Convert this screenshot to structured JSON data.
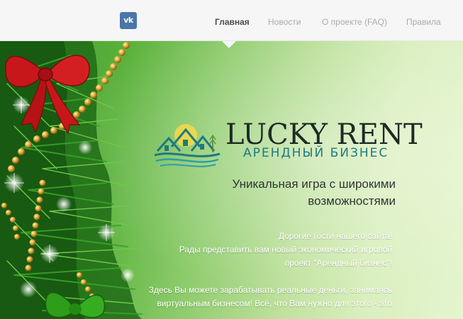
{
  "header": {
    "vk_icon": "vk-icon",
    "vk_text": "vk",
    "nav": [
      {
        "label": "Главная",
        "active": true
      },
      {
        "label": "Новости",
        "active": false
      },
      {
        "label": "О проекте (FAQ)",
        "active": false
      },
      {
        "label": "Правила",
        "active": false
      }
    ]
  },
  "hero": {
    "logo": {
      "title": "LUCKY RENT",
      "subtitle": "АРЕНДНЫЙ БИЗНЕС"
    },
    "tagline_line1": "Уникальная игра с широкими",
    "tagline_line2": "возможностями",
    "paragraph1_lines": [
      "Дорогие гости нашего сайта!",
      "Рады представить вам новый экономический игровой",
      "проект \"Арендный бизнес\"!"
    ],
    "paragraph2_lines": [
      "Здесь Вы можете зарабатывать реальные деньги, занимаясь",
      "виртуальным бизнесом! Всё, что Вам нужно для этого - это"
    ]
  },
  "colors": {
    "nav_active": "#4a4d4f",
    "nav_inactive": "#a8acaf",
    "vk_blue": "#4a76a8",
    "logo_teal": "#1d7a7f",
    "hero_green_dark": "#3f9d2a",
    "hero_green_light": "#e4f5cf",
    "ribbon_red": "#c8171b"
  }
}
